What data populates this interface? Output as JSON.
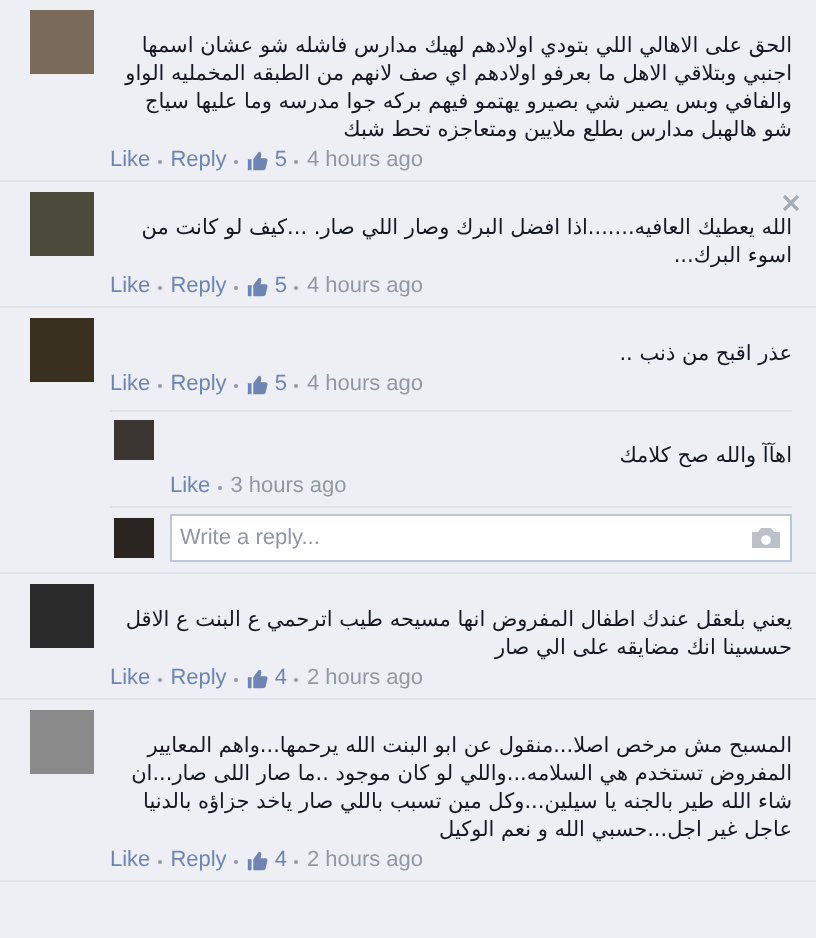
{
  "comments": [
    {
      "text": "الحق على الاهالي اللي بتودي اولادهم لهيك مدارس فاشله شو عشان اسمها اجنبي وبتلاقي الاهل ما بعرفو اولادهم اي صف لانهم من الطبقه المخمليه الواو والفافي وبس يصير شي بصيرو يهتمو فيهم بركه جوا مدرسه وما عليها سياج شو هالهبل مدارس بطلع ملايين ومتعاجزه تحط شبك",
      "like": "Like",
      "reply": "Reply",
      "likes": "5",
      "time": "4 hours ago",
      "closable": false
    },
    {
      "text": "الله يعطيك العافيه.......اذا افضل البرك وصار اللي صار. ...كيف لو كانت من اسوء البرك...",
      "like": "Like",
      "reply": "Reply",
      "likes": "5",
      "time": "4 hours ago",
      "closable": true
    },
    {
      "text": "عذر اقبح من ذنب ..",
      "like": "Like",
      "reply": "Reply",
      "likes": "5",
      "time": "4 hours ago",
      "closable": false,
      "replies": [
        {
          "text": "اهآآ والله صح كلامك",
          "like": "Like",
          "time": "3 hours ago"
        }
      ],
      "reply_box": {
        "placeholder": "Write a reply..."
      }
    },
    {
      "text": "يعني بلعقل عندك اطفال المفروض انها مسيحه طيب اترحمي ع البنت ع الاقل حسسينا انك مضايقه على الي صار",
      "like": "Like",
      "reply": "Reply",
      "likes": "4",
      "time": "2 hours ago",
      "closable": false
    },
    {
      "text": "المسبح مش مرخص اصلا...منقول عن ابو البنت الله يرحمها...واهم المعايير المفروض تستخدم هي السلامه...واللي لو كان موجود ..ما صار اللى صار...ان شاء الله طير بالجنه يا سيلين...وكل مين تسبب باللي صار ياخد جزاؤه بالدنيا عاجل غير اجل...حسبي الله و نعم الوكيل",
      "like": "Like",
      "reply": "Reply",
      "likes": "4",
      "time": "2 hours ago",
      "closable": false
    }
  ]
}
